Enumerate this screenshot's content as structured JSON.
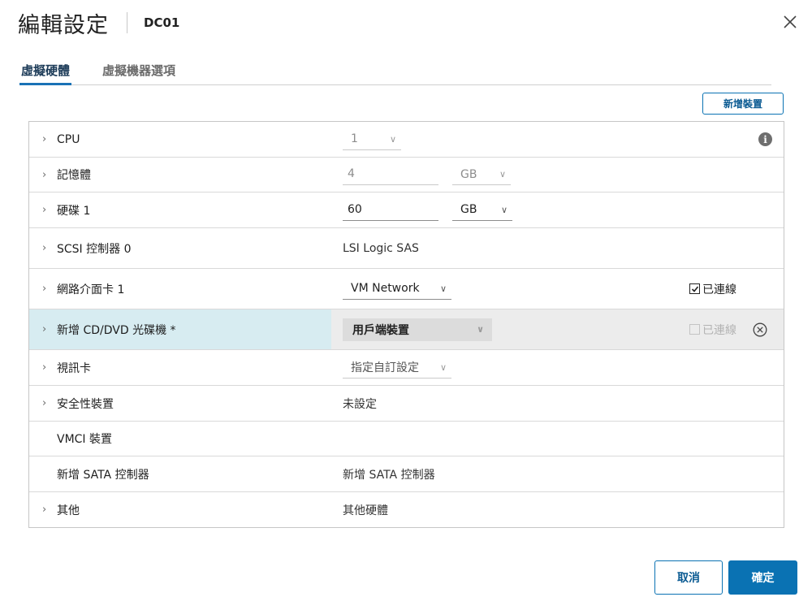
{
  "dialog": {
    "title": "編輯設定",
    "vm_name": "DC01"
  },
  "tabs": [
    {
      "label": "虛擬硬體",
      "active": true
    },
    {
      "label": "虛擬機器選項",
      "active": false
    }
  ],
  "add_device_label": "新增裝置",
  "rows": {
    "cpu": {
      "label": "CPU",
      "value": "1"
    },
    "memory": {
      "label": "記憶體",
      "value": "4",
      "unit": "GB"
    },
    "disk": {
      "label": "硬碟 1",
      "value": "60",
      "unit": "GB"
    },
    "scsi": {
      "label": "SCSI 控制器 0",
      "value": "LSI Logic SAS"
    },
    "network": {
      "label": "網路介面卡 1",
      "value": "VM Network",
      "connected_label": "已連線",
      "connected": true
    },
    "cddvd": {
      "label": "新增 CD/DVD 光碟機 *",
      "value": "用戶端裝置",
      "connected_label": "已連線",
      "connected": false
    },
    "video": {
      "label": "視訊卡",
      "value": "指定自訂設定"
    },
    "security": {
      "label": "安全性裝置",
      "value": "未設定"
    },
    "vmci": {
      "label": "VMCI 裝置"
    },
    "sata": {
      "label": "新增 SATA 控制器",
      "value": "新增 SATA 控制器"
    },
    "other": {
      "label": "其他",
      "value": "其他硬體"
    }
  },
  "footer": {
    "cancel_label": "取消",
    "ok_label": "確定"
  },
  "colors": {
    "accent": "#0a72b3",
    "highlight_row": "#d7ecf1"
  }
}
